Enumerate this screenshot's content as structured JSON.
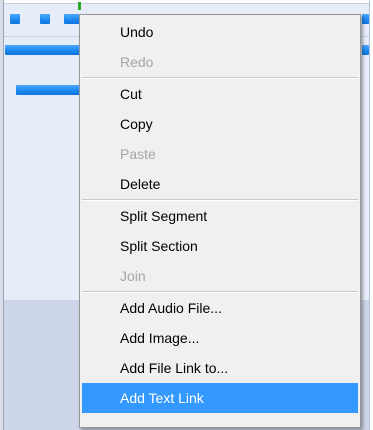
{
  "context_menu": {
    "groups": [
      [
        {
          "label": "Undo",
          "enabled": true
        },
        {
          "label": "Redo",
          "enabled": false
        }
      ],
      [
        {
          "label": "Cut",
          "enabled": true
        },
        {
          "label": "Copy",
          "enabled": true
        },
        {
          "label": "Paste",
          "enabled": false
        },
        {
          "label": "Delete",
          "enabled": true
        }
      ],
      [
        {
          "label": "Split Segment",
          "enabled": true
        },
        {
          "label": "Split Section",
          "enabled": true
        },
        {
          "label": "Join",
          "enabled": false
        }
      ],
      [
        {
          "label": "Add Audio File...",
          "enabled": true
        },
        {
          "label": "Add Image...",
          "enabled": true
        },
        {
          "label": "Add File Link to...",
          "enabled": true
        },
        {
          "label": "Add Text Link",
          "enabled": true,
          "highlighted": true
        }
      ]
    ]
  },
  "colors": {
    "segment_blue": "#1b86f0",
    "highlight": "#3399ff",
    "menu_background": "#f0f0f0",
    "disabled_text": "#a6a6a6"
  }
}
